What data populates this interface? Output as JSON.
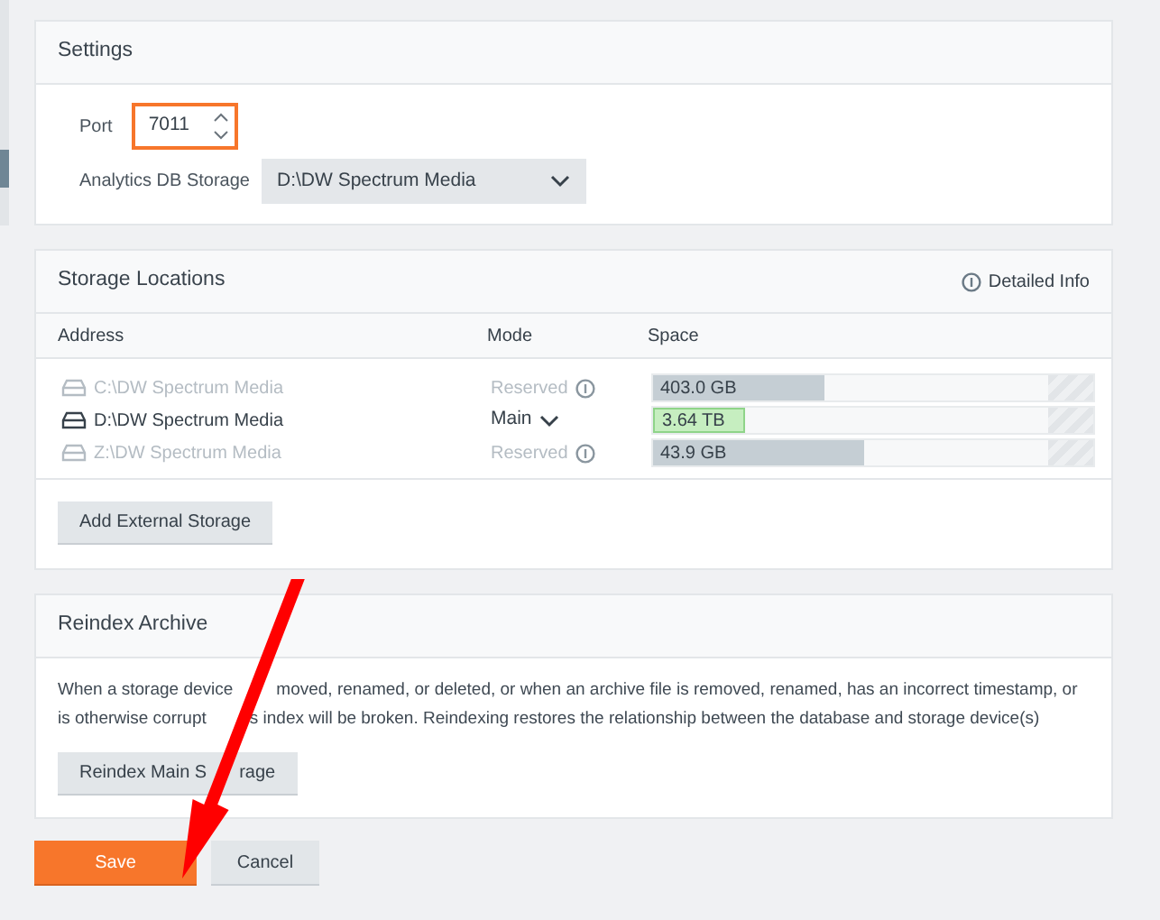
{
  "settings": {
    "title": "Settings",
    "port": {
      "label": "Port",
      "value": "7011",
      "focused": true
    },
    "analytics": {
      "label": "Analytics DB Storage",
      "value": "D:\\DW Spectrum Media"
    }
  },
  "storage": {
    "title": "Storage Locations",
    "detail_link": "Detailed Info",
    "columns": [
      "Address",
      "Mode",
      "Space"
    ],
    "rows": [
      {
        "address": "C:\\DW Spectrum Media",
        "disabled": true,
        "kind": "reserved",
        "mode": "Reserved",
        "space": "403.0 GB",
        "level": 0.39
      },
      {
        "address": "D:\\DW Spectrum Media",
        "disabled": false,
        "kind": "main",
        "mode": "Main",
        "space": "3.64 TB",
        "level": 0.21
      },
      {
        "address": "Z:\\DW Spectrum Media",
        "disabled": true,
        "kind": "reserved",
        "mode": "Reserved",
        "space": "43.9 GB",
        "level": 0.48
      }
    ],
    "add_button": "Add External Storage"
  },
  "reindex": {
    "title": "Reindex Archive",
    "description_lines": [
      [
        "When a storage device",
        "moved, renamed, or deleted, or when an archive file is removed, renamed, has an incorrect timestamp, or"
      ],
      [
        "is otherwise corrupt",
        "s index will be broken. Reindexing restores the relationship between the database and storage device(s)"
      ]
    ],
    "button_parts": [
      "Reindex Main S",
      "rage"
    ]
  },
  "buttons": [
    {
      "label": "Save",
      "kind": "primary"
    },
    {
      "label": "Cancel",
      "kind": "secondary"
    }
  ]
}
